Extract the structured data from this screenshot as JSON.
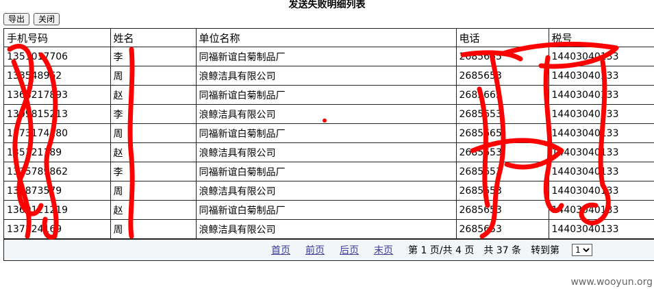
{
  "page_title": "发送失败明细列表",
  "toolbar": {
    "export_label": "导出",
    "close_label": "关闭"
  },
  "table": {
    "headers": [
      "手机号码",
      "姓名",
      "单位名称",
      "电话",
      "税号"
    ],
    "rows": [
      [
        "1351017706",
        "李",
        "同福新谊白菊制品厂",
        "2685665",
        "14403040133"
      ],
      [
        "133548962",
        "周",
        "浪鲸洁具有限公司",
        "2685653",
        "14403040133"
      ],
      [
        "1368217893",
        "赵",
        "同福新谊白菊制品厂",
        "2685665",
        "14403040133"
      ],
      [
        "1309815213",
        "李",
        "浪鲸洁具有限公司",
        "2685653",
        "14403040133"
      ],
      [
        "1373174180",
        "周",
        "同福新谊白菊制品厂",
        "2685665",
        "14403040133"
      ],
      [
        "135121189",
        "赵",
        "浪鲸洁具有限公司",
        "2685653",
        "14403040133"
      ],
      [
        "1335789862",
        "李",
        "同福新谊白菊制品厂",
        "2685653",
        "14403040133"
      ],
      [
        "136873579",
        "周",
        "浪鲸洁具有限公司",
        "2685653",
        "14403040133"
      ],
      [
        "1369121219",
        "赵",
        "同福新谊白菊制品厂",
        "2685653",
        "14403040133"
      ],
      [
        "137124169",
        "周",
        "浪鲸洁具有限公司",
        "2685653",
        "14403040133"
      ]
    ]
  },
  "pager": {
    "first": "首页",
    "prev": "前页",
    "next": "后页",
    "last": "末页",
    "page_info": "第 1 页/共 4 页",
    "total_info": "共 37 条",
    "goto_label": "转到第",
    "selected_page": "1"
  },
  "watermark": "www.wooyun.org",
  "colors": {
    "scribble": "#ff0000",
    "link": "#3b3b9a",
    "pager_bg": "#f3f6f9"
  }
}
